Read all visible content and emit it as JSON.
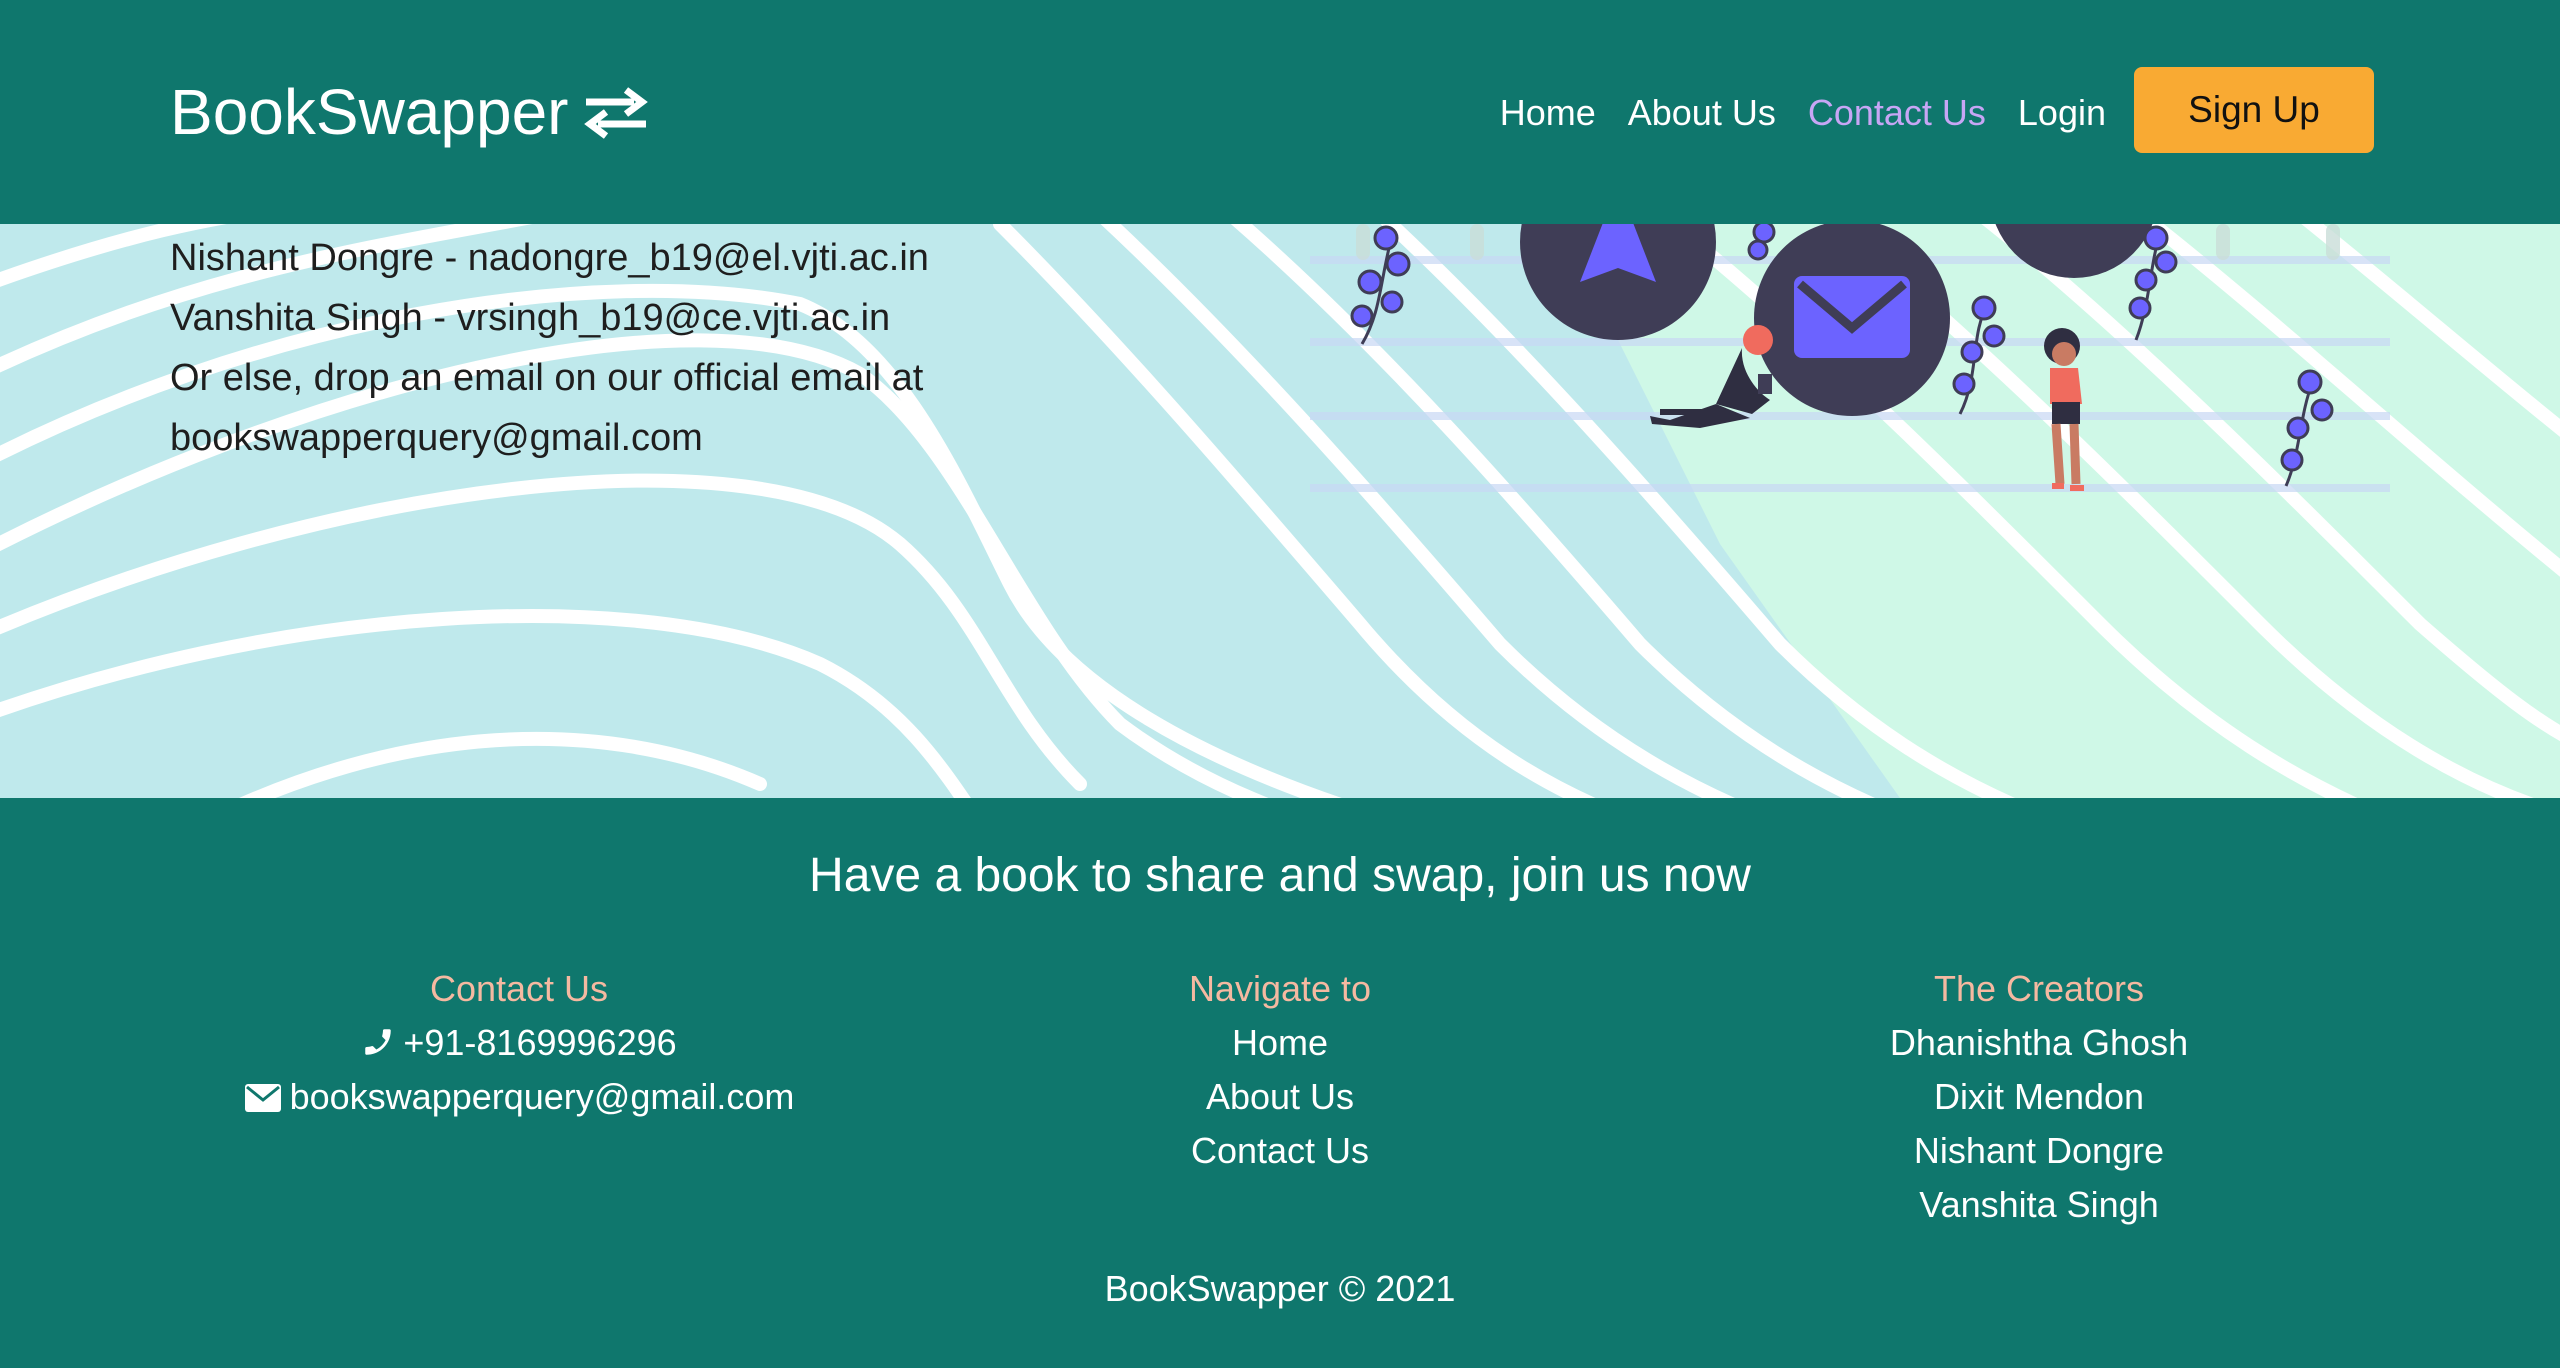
{
  "navbar": {
    "brand": "BookSwapper",
    "brand_icon": "swap-arrows-icon",
    "links": [
      {
        "label": "Home",
        "active": false
      },
      {
        "label": "About Us",
        "active": false
      },
      {
        "label": "Contact Us",
        "active": true
      },
      {
        "label": "Login",
        "active": false
      }
    ],
    "signup_label": "Sign Up"
  },
  "contact": {
    "lines": [
      "Nishant Dongre - nadongre_b19@el.vjti.ac.in",
      "Vanshita Singh - vrsingh_b19@ce.vjti.ac.in",
      "Or else, drop an email on our official email at",
      "bookswapperquery@gmail.com"
    ]
  },
  "footer": {
    "cta": "Have a book to share and swap, join us now",
    "contact": {
      "title": "Contact Us",
      "phone": "+91-8169996296",
      "email": "bookswapperquery@gmail.com"
    },
    "navigate": {
      "title": "Navigate to",
      "items": [
        "Home",
        "About Us",
        "Contact Us"
      ]
    },
    "creators": {
      "title": "The Creators",
      "items": [
        "Dhanishtha Ghosh",
        "Dixit Mendon",
        "Nishant Dongre",
        "Vanshita Singh"
      ]
    },
    "copyright": "BookSwapper © 2021"
  },
  "colors": {
    "primary": "#0f776d",
    "accent_button": "#f9aa33",
    "active_link": "#c7a6f5",
    "footer_heading": "#f5b9a1",
    "hero_bg": "#bfe9ec",
    "hero_bg_right": "#cff8e7",
    "illustration_purple": "#6c63ff",
    "illustration_dark": "#3f3d56"
  }
}
